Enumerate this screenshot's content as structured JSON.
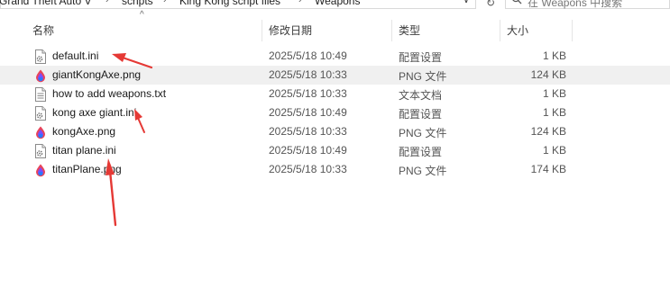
{
  "breadcrumb": [
    "Grand Theft Auto V",
    "scripts",
    "King Kong script files",
    "Weapons"
  ],
  "search": {
    "placeholder": "在 Weapons 中搜索"
  },
  "columns": {
    "name": "名称",
    "date": "修改日期",
    "type": "类型",
    "size": "大小"
  },
  "files": [
    {
      "name": "default.ini",
      "date": "2025/5/18 10:49",
      "type": "配置设置",
      "size": "1 KB",
      "icon": "ini-settings-icon"
    },
    {
      "name": "giantKongAxe.png",
      "date": "2025/5/18 10:33",
      "type": "PNG 文件",
      "size": "124 KB",
      "icon": "png-image-icon",
      "selected": true
    },
    {
      "name": "how to add weapons.txt",
      "date": "2025/5/18 10:33",
      "type": "文本文档",
      "size": "1 KB",
      "icon": "text-document-icon"
    },
    {
      "name": "kong axe giant.ini",
      "date": "2025/5/18 10:49",
      "type": "配置设置",
      "size": "1 KB",
      "icon": "ini-settings-icon"
    },
    {
      "name": "kongAxe.png",
      "date": "2025/5/18 10:33",
      "type": "PNG 文件",
      "size": "124 KB",
      "icon": "png-image-icon"
    },
    {
      "name": "titan plane.ini",
      "date": "2025/5/18 10:49",
      "type": "配置设置",
      "size": "1 KB",
      "icon": "ini-settings-icon"
    },
    {
      "name": "titanPlane.png",
      "date": "2025/5/18 10:33",
      "type": "PNG 文件",
      "size": "174 KB",
      "icon": "png-image-icon"
    }
  ],
  "colors": {
    "annotation_arrow": "#e53935",
    "selected_row": "#f0f0f0"
  }
}
